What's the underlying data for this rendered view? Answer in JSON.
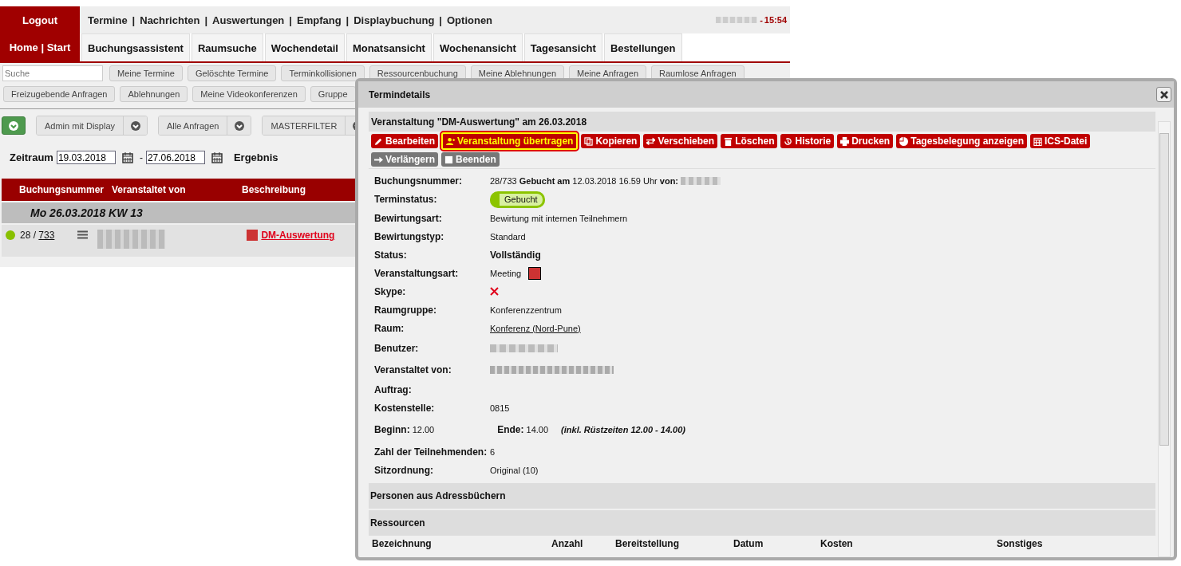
{
  "top_nav": {
    "logout": "Logout",
    "separator": "|",
    "links": [
      "Termine",
      "Nachrichten",
      "Auswertungen",
      "Empfang",
      "Displaybuchung",
      "Optionen"
    ],
    "clock_dash": "-",
    "clock": "15:54"
  },
  "tabs": [
    {
      "label": "Home | Start",
      "selected": true
    },
    {
      "label": "Buchungsassistent",
      "selected": false
    },
    {
      "label": "Raumsuche",
      "selected": false
    },
    {
      "label": "Wochendetail",
      "selected": false
    },
    {
      "label": "Monatsansicht",
      "selected": false
    },
    {
      "label": "Wochenansicht",
      "selected": false
    },
    {
      "label": "Tagesansicht",
      "selected": false
    },
    {
      "label": "Bestellungen",
      "selected": false
    }
  ],
  "search": {
    "placeholder": "Suche"
  },
  "quick_buttons": [
    [
      "Meine Termine",
      "Gelöschte Termine",
      "Terminkollisionen",
      "Ressourcenbuchung",
      "Meine Ablehnungen",
      "Meine Anfragen",
      "Raumlose Anfragen"
    ],
    [
      "Freizugebende Anfragen",
      "Ablehnungen",
      "Meine Videokonferenzen",
      "Gruppe"
    ]
  ],
  "filters": [
    "Admin mit Display",
    "Alle Anfragen",
    "MASTERFILTER"
  ],
  "period": {
    "label": "Zeitraum",
    "from": "19.03.2018",
    "dash": "-",
    "to": "27.06.2018",
    "result": "Ergebnis"
  },
  "table": {
    "columns": [
      "Buchungsnummer",
      "Veranstaltet von",
      "Beschreibung"
    ],
    "group": "Mo 26.03.2018 KW 13",
    "rows": [
      {
        "number": "28 / ",
        "number_link": "733",
        "description": "DM-Auswertung"
      }
    ]
  },
  "dialog": {
    "title": "Termindetails",
    "heading": "Veranstaltung \"DM-Auswertung\" am 26.03.2018",
    "buttons": [
      {
        "label": "Bearbeiten",
        "selected": false,
        "disabled": false
      },
      {
        "label": "Veranstaltung übertragen",
        "selected": true,
        "disabled": false
      },
      {
        "label": "Kopieren",
        "selected": false,
        "disabled": false
      },
      {
        "label": "Verschieben",
        "selected": false,
        "disabled": false
      },
      {
        "label": "Löschen",
        "selected": false,
        "disabled": false
      },
      {
        "label": "Historie",
        "selected": false,
        "disabled": false
      },
      {
        "label": "Drucken",
        "selected": false,
        "disabled": false
      },
      {
        "label": "Tagesbelegung anzeigen",
        "selected": false,
        "disabled": false
      },
      {
        "label": "ICS-Datei",
        "selected": false,
        "disabled": false
      },
      {
        "label": "Verlängern",
        "selected": false,
        "disabled": true
      },
      {
        "label": "Beenden",
        "selected": false,
        "disabled": true
      }
    ],
    "details": [
      {
        "kind": "rich",
        "label": "Buchungsnummer:",
        "value": "28/733 **Gebucht am** 12.03.2018 16.59 Uhr **von:**"
      },
      {
        "kind": "status",
        "label": "Terminstatus:",
        "value": "Gebucht"
      },
      {
        "kind": "text",
        "label": "Bewirtungsart:",
        "value": "Bewirtung mit internen Teilnehmern"
      },
      {
        "kind": "text",
        "label": "Bewirtungstyp:",
        "value": "Standard"
      },
      {
        "kind": "bold",
        "label": "Status:",
        "value": "Vollständig"
      },
      {
        "kind": "swatch",
        "label": "Veranstaltungsart:",
        "value": "Meeting",
        "color": "#cc3333"
      },
      {
        "kind": "cross",
        "label": "Skype:"
      },
      {
        "kind": "text",
        "label": "Raumgruppe:",
        "value": "Konferenzzentrum"
      },
      {
        "kind": "link",
        "label": "Raum:",
        "value": "Konferenz (Nord-Pune)"
      },
      {
        "kind": "hidden",
        "label": "Benutzer:"
      },
      {
        "kind": "hidden",
        "label": "Veranstaltet von:"
      },
      {
        "kind": "empty",
        "label": "Auftrag:"
      },
      {
        "kind": "text",
        "label": "Kostenstelle:",
        "value": "0815"
      },
      {
        "kind": "times",
        "label": "Beginn:",
        "value": "12.00",
        "end_label": "Ende:",
        "end_value": "14.00",
        "note": "(inkl. Rüstzeiten 12.00 - 14.00)"
      },
      {
        "kind": "text",
        "label": "Zahl der Teilnehmenden:",
        "value": "6"
      },
      {
        "kind": "text",
        "label": "Sitzordnung:",
        "value": "Original (10)"
      }
    ],
    "sections": [
      "Personen aus Adressbüchern",
      "Ressourcen"
    ],
    "resource_columns": [
      "Bezeichnung",
      "Anzahl",
      "Bereitstellung",
      "Datum",
      "Kosten",
      "Sonstiges"
    ]
  }
}
